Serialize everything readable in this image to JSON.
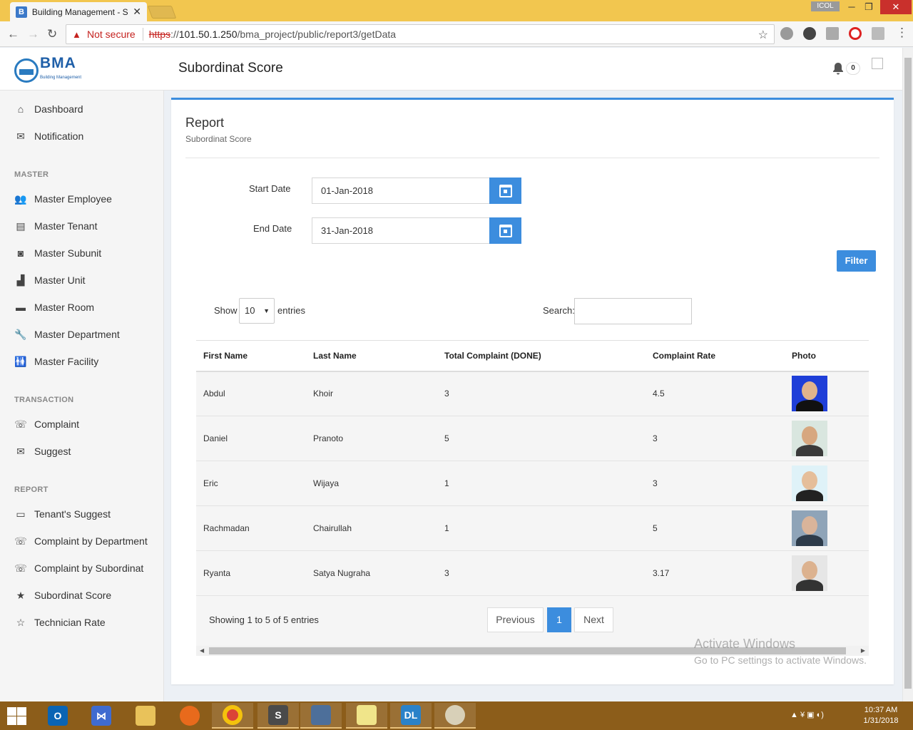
{
  "browser": {
    "tab_title": "Building Management - S",
    "tab_favicon": "B",
    "window_user": "ICOL",
    "security_label": "Not secure",
    "url_scheme": "https",
    "url_sep": "://",
    "url_host": "101.50.1.250",
    "url_path": "/bma_project/public/report3/getData"
  },
  "app": {
    "logo_text": "BMA",
    "logo_subtitle": "Building Management",
    "page_title": "Subordinat Score",
    "notification_count": "0"
  },
  "sidebar": {
    "top_items": [
      {
        "label": "Dashboard",
        "icon": "home-icon"
      },
      {
        "label": "Notification",
        "icon": "envelope-icon"
      }
    ],
    "sections": [
      {
        "heading": "MASTER",
        "items": [
          {
            "label": "Master Employee",
            "icon": "people-icon"
          },
          {
            "label": "Master Tenant",
            "icon": "tenant-icon"
          },
          {
            "label": "Master Subunit",
            "icon": "subunit-icon"
          },
          {
            "label": "Master Unit",
            "icon": "unit-icon"
          },
          {
            "label": "Master Room",
            "icon": "bed-icon"
          },
          {
            "label": "Master Department",
            "icon": "wrench-icon"
          },
          {
            "label": "Master Facility",
            "icon": "facility-icon"
          }
        ]
      },
      {
        "heading": "TRANSACTION",
        "items": [
          {
            "label": "Complaint",
            "icon": "phone-icon"
          },
          {
            "label": "Suggest",
            "icon": "envelope-icon"
          }
        ]
      },
      {
        "heading": "REPORT",
        "items": [
          {
            "label": "Tenant's Suggest",
            "icon": "comment-icon"
          },
          {
            "label": "Complaint by Department",
            "icon": "phone-forward-icon"
          },
          {
            "label": "Complaint by Subordinat",
            "icon": "phone-forward-icon"
          },
          {
            "label": "Subordinat Score",
            "icon": "star-filled-icon"
          },
          {
            "label": "Technician Rate",
            "icon": "star-outline-icon"
          }
        ]
      }
    ]
  },
  "report": {
    "title": "Report",
    "subtitle": "Subordinat Score",
    "start_label": "Start Date",
    "start_value": "01-Jan-2018",
    "end_label": "End Date",
    "end_value": "31-Jan-2018",
    "filter_label": "Filter"
  },
  "table": {
    "show_label": "Show",
    "entries_value": "10",
    "entries_label": "entries",
    "search_label": "Search:",
    "columns": [
      "First Name",
      "Last Name",
      "Total Complaint (DONE)",
      "Complaint Rate",
      "Photo"
    ],
    "rows": [
      {
        "first": "Abdul",
        "last": "Khoir",
        "total": "3",
        "rate": "4.5",
        "photo_bg": "#1f3fd8",
        "face": "#e1b48c",
        "body": "#111111"
      },
      {
        "first": "Daniel",
        "last": "Pranoto",
        "total": "5",
        "rate": "3",
        "photo_bg": "#d9e6df",
        "face": "#d7a77f",
        "body": "#3a3a3a"
      },
      {
        "first": "Eric",
        "last": "Wijaya",
        "total": "1",
        "rate": "3",
        "photo_bg": "#dff2f8",
        "face": "#e5be9a",
        "body": "#222222"
      },
      {
        "first": "Rachmadan",
        "last": "Chairullah",
        "total": "1",
        "rate": "5",
        "photo_bg": "#8fa4b8",
        "face": "#d9b49a",
        "body": "#2d3b4a"
      },
      {
        "first": "Ryanta",
        "last": "Satya Nugraha",
        "total": "3",
        "rate": "3.17",
        "photo_bg": "#e6e6e6",
        "face": "#dcb28f",
        "body": "#333333"
      }
    ],
    "showing_text": "Showing 1 to 5 of 5 entries",
    "prev_label": "Previous",
    "current_page": "1",
    "next_label": "Next"
  },
  "watermark": {
    "line1": "Activate Windows",
    "line2": "Go to PC settings to activate Windows."
  },
  "taskbar": {
    "time": "10:37 AM",
    "date": "1/31/2018"
  },
  "colors": {
    "accent": "#3c8dde",
    "titlebar": "#f2c64f",
    "taskbar": "#8c5d1a"
  }
}
